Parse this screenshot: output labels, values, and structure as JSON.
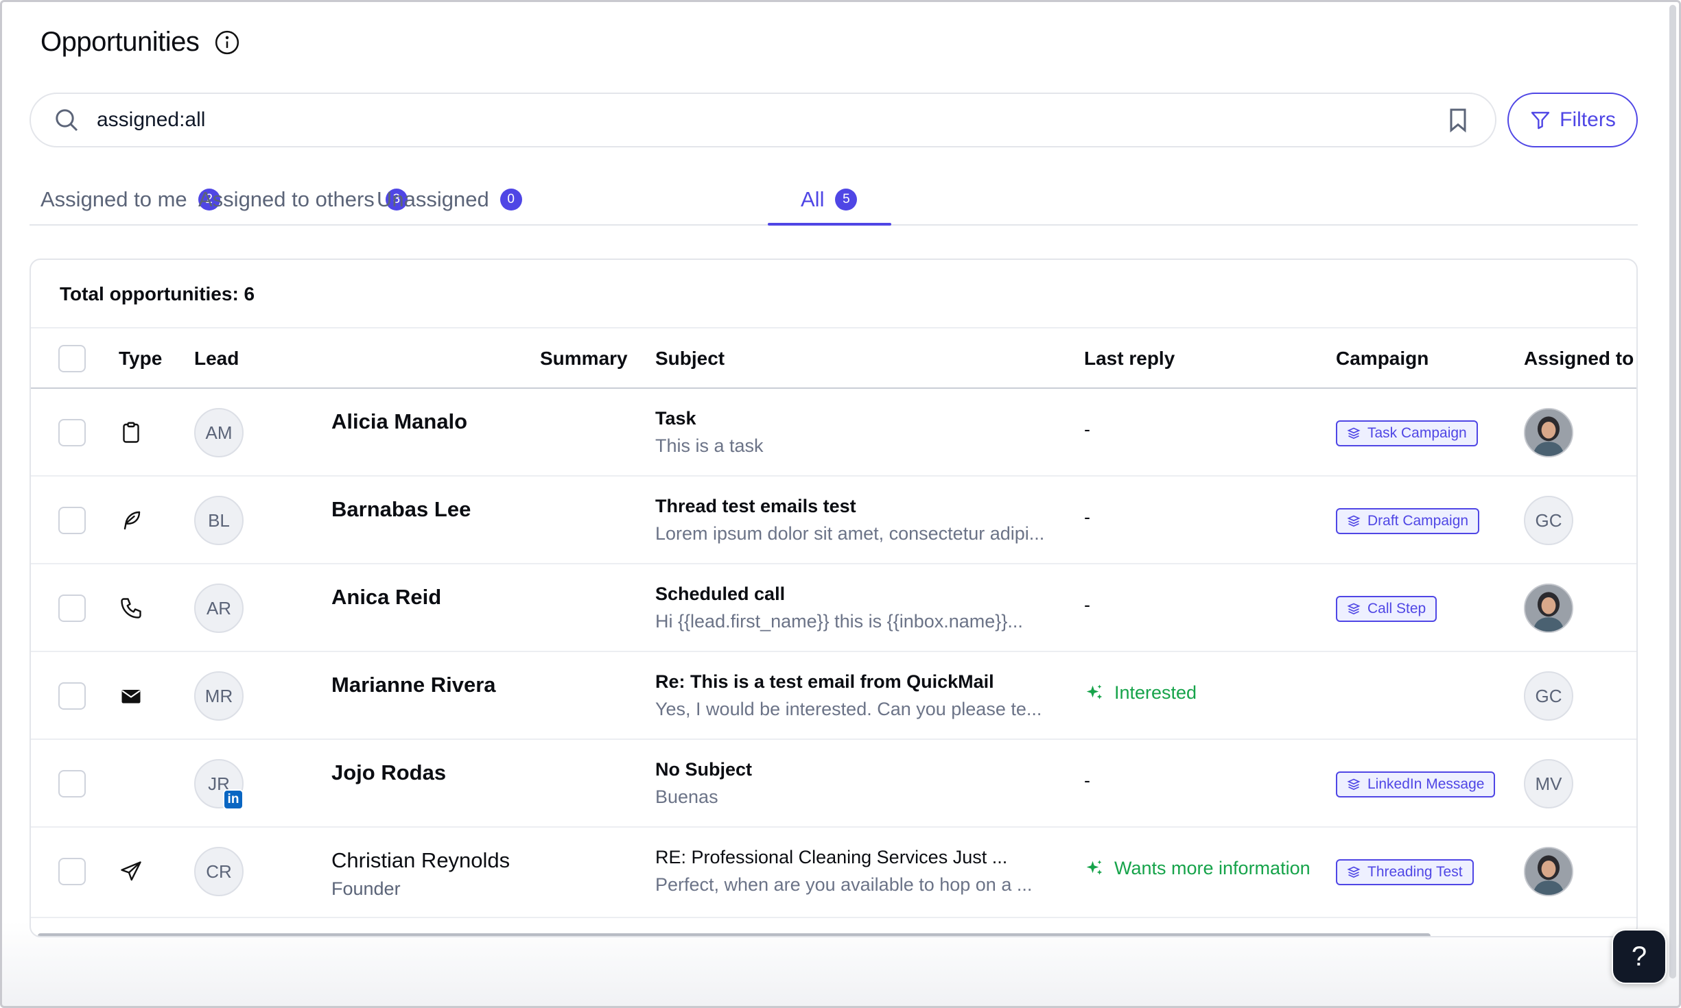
{
  "page": {
    "title": "Opportunities",
    "icons": {
      "info": "info-icon"
    }
  },
  "search": {
    "value": "assigned:all",
    "icons": {
      "search": "search-icon",
      "bookmark": "bookmark-icon"
    }
  },
  "filters": {
    "label": "Filters",
    "icon": "filter-icon"
  },
  "tabs": [
    {
      "label": "Assigned to me",
      "count": "2",
      "active": false
    },
    {
      "label": "Assigned to others",
      "count": "3",
      "active": false
    },
    {
      "label": "Unassigned",
      "count": "0",
      "active": false
    },
    {
      "label": "All",
      "count": "5",
      "active": true
    }
  ],
  "table": {
    "total": "Total opportunities: 6",
    "columns": {
      "type": "Type",
      "lead": "Lead",
      "summary": "Summary",
      "subject": "Subject",
      "last_reply": "Last reply",
      "campaign": "Campaign",
      "assigned_to": "Assigned to"
    },
    "rows": [
      {
        "type_icon": "clipboard-icon",
        "initials": "AM",
        "name": "Alicia Manalo",
        "subject": "Task",
        "preview": "This is a task",
        "last_reply": "-",
        "campaign": "Task Campaign",
        "assignee": "photo"
      },
      {
        "type_icon": "feather-icon",
        "initials": "BL",
        "name": "Barnabas Lee",
        "subject": "Thread test emails test",
        "preview": "Lorem ipsum dolor sit amet, consectetur adipi...",
        "last_reply": "-",
        "campaign": "Draft Campaign",
        "assignee": "GC"
      },
      {
        "type_icon": "phone-icon",
        "initials": "AR",
        "name": "Anica Reid",
        "subject": "Scheduled call",
        "preview": "Hi {{lead.first_name}} this is {{inbox.name}}...",
        "last_reply": "-",
        "campaign": "Call Step",
        "assignee": "photo"
      },
      {
        "type_icon": "envelope-icon",
        "initials": "MR",
        "name": "Marianne Rivera",
        "subject": "Re: This is a test email from QuickMail",
        "preview": "Yes, I would be interested. Can you please te...",
        "last_reply": "Interested",
        "campaign": "",
        "assignee": "GC"
      },
      {
        "type_icon": "",
        "initials": "JR",
        "name": "Jojo Rodas",
        "subject": "No Subject",
        "preview": "Buenas",
        "last_reply": "-",
        "campaign": "LinkedIn Message",
        "assignee": "MV",
        "badge": "in"
      },
      {
        "type_icon": "send-icon",
        "initials": "CR",
        "name": "Christian Reynolds",
        "title": "Founder",
        "subject": "RE: Professional Cleaning Services Just ...",
        "preview": "Perfect, when are you available to hop on a ...",
        "last_reply": "Wants more information",
        "campaign": "Threading Test",
        "assignee": "photo"
      }
    ]
  },
  "help": {
    "label": "?"
  },
  "colors": {
    "accent": "#4f46e5",
    "success": "#16a34a",
    "linkedin": "#0a66c2"
  }
}
